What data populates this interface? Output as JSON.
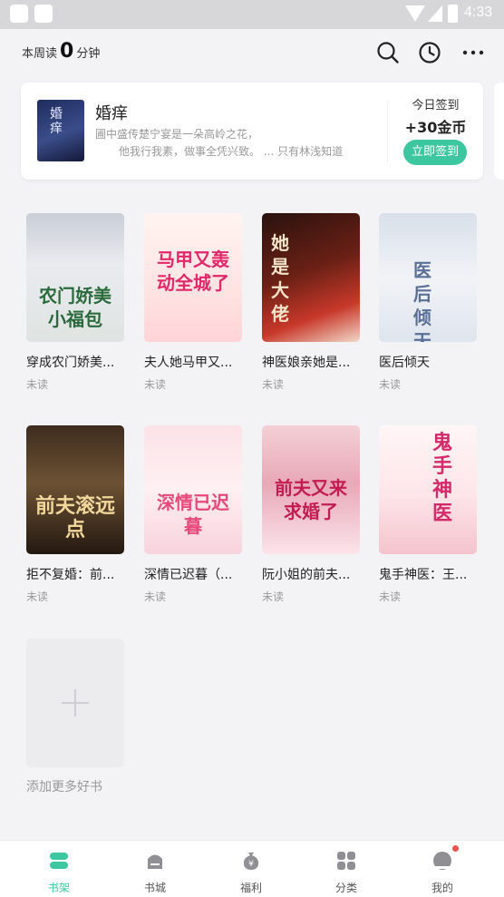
{
  "status_bar": {
    "time": "4:33"
  },
  "header": {
    "weekly_prefix": "本周读",
    "weekly_minutes": "0",
    "weekly_suffix": "分钟",
    "icons": [
      "search-icon",
      "history-clock-icon",
      "more-icon"
    ]
  },
  "signin_card": {
    "book_title": "婚痒",
    "cover_text": "婚痒",
    "desc_line1": "圃中盛传楚宁宴是一朵高岭之花，",
    "desc_line2": "他我行我素，做事全凭兴致。 ...     只有林浅知道",
    "sign_label": "今日签到",
    "sign_reward": "+30金币",
    "sign_button": "立即签到"
  },
  "books": [
    {
      "title": "穿成农门娇美...",
      "status": "未读",
      "cover_text": "农门娇美小福包"
    },
    {
      "title": "夫人她马甲又...",
      "status": "未读",
      "cover_text": "马甲又轰动全城了"
    },
    {
      "title": "神医娘亲她是...",
      "status": "未读",
      "cover_text": "她是大佬"
    },
    {
      "title": "医后倾天",
      "status": "未读",
      "cover_text": "医后倾天"
    },
    {
      "title": "拒不复婚：前...",
      "status": "未读",
      "cover_text": "前夫滚远点"
    },
    {
      "title": "深情已迟暮（...",
      "status": "未读",
      "cover_text": "深情已迟暮"
    },
    {
      "title": "阮小姐的前夫...",
      "status": "未读",
      "cover_text": "前夫又来求婚了"
    },
    {
      "title": "鬼手神医：王...",
      "status": "未读",
      "cover_text": "鬼手神医"
    }
  ],
  "add_more": "添加更多好书",
  "tabs": [
    {
      "label": "书架",
      "icon": "bookshelf-icon",
      "active": true
    },
    {
      "label": "书城",
      "icon": "bookstore-icon"
    },
    {
      "label": "福利",
      "icon": "welfare-coin-icon"
    },
    {
      "label": "分类",
      "icon": "category-grid-icon"
    },
    {
      "label": "我的",
      "icon": "profile-icon"
    }
  ],
  "colors": {
    "accent": "#3dc7a0",
    "badge": "#f2524b"
  }
}
